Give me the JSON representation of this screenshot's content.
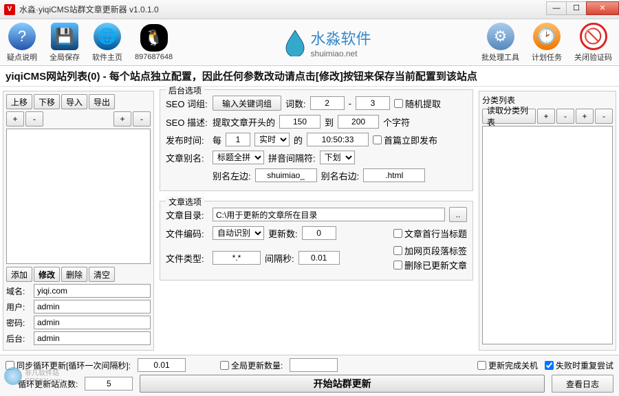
{
  "window": {
    "title": "水淼·yiqiCMS站群文章更新器 v1.0.1.0",
    "min": "—",
    "max": "☐",
    "close": "✕"
  },
  "toolbar": {
    "help": "疑点说明",
    "save": "全局保存",
    "home": "软件主页",
    "qq": "897687648",
    "batch": "批处理工具",
    "schedule": "计划任务",
    "captcha": "关闭验证码"
  },
  "brand": {
    "cn": "水淼软件",
    "en": "shuimiao.net"
  },
  "banner": "yiqiCMS网站列表(0) - 每个站点独立配置，因此任何参数改动请点击[修改]按钮来保存当前配置到该站点",
  "left": {
    "up": "上移",
    "down": "下移",
    "import": "导入",
    "export": "导出",
    "plus": "+",
    "minus": "-",
    "add": "添加",
    "modify": "修改",
    "delete": "删除",
    "clear": "清空",
    "domain_label": "域名:",
    "domain": "yiqi.com",
    "user_label": "用户:",
    "user": "admin",
    "pass_label": "密码:",
    "pass": "admin",
    "admin_label": "后台:",
    "admin": "admin"
  },
  "backend": {
    "title": "后台选项",
    "seo_word_label": "SEO 词组:",
    "seo_word_btn": "输入关键词组",
    "word_count_label": "词数:",
    "word_count_from": "2",
    "word_count_to": "3",
    "random_extract": "随机提取",
    "seo_desc_label": "SEO 描述:",
    "seo_desc_prefix": "提取文章开头的",
    "seo_desc_from": "150",
    "seo_desc_mid": "到",
    "seo_desc_to": "200",
    "seo_desc_suffix": "个字符",
    "publish_label": "发布时间:",
    "publish_every": "每",
    "publish_n": "1",
    "publish_realtime": "实时",
    "publish_of": "的",
    "publish_time": "10:50:33",
    "publish_first": "首篇立即发布",
    "alias_label": "文章别名:",
    "alias_mode": "标题全拼",
    "pinyin_sep_label": "拼音间隔符:",
    "pinyin_sep": "下划",
    "alias_left_label": "别名左边:",
    "alias_left": "shuimiao_",
    "alias_right_label": "别名右边:",
    "alias_right": ".html"
  },
  "article": {
    "title": "文章选项",
    "dir_label": "文章目录:",
    "dir": "C:\\用于更新的文章所在目录",
    "browse": "..",
    "encoding_label": "文件编码:",
    "encoding": "自动识别",
    "update_count_label": "更新数:",
    "update_count": "0",
    "filetype_label": "文件类型:",
    "filetype": "*.*",
    "interval_label": "间隔秒:",
    "interval": "0.01",
    "first_title": "文章首行当标题",
    "add_tag": "加网页段落标签",
    "del_updated": "删除已更新文章"
  },
  "right": {
    "title": "分类列表",
    "read": "读取分类列表",
    "plus": "+",
    "minus": "-",
    "plus2": "+",
    "minus2": "-"
  },
  "footer": {
    "sync_label": "同步循环更新[循环一次间隔秒]:",
    "sync_val": "0.01",
    "global_count_label": "全局更新数量:",
    "global_count": "",
    "shutdown": "更新完成关机",
    "retry": "失败时重复尝试",
    "loop_label": "循环更新站点数:",
    "loop_val": "5",
    "start": "开始站群更新",
    "log": "查看日志"
  },
  "watermark": {
    "text1": "非凡软件站",
    "text2": "CRSKY.com"
  }
}
